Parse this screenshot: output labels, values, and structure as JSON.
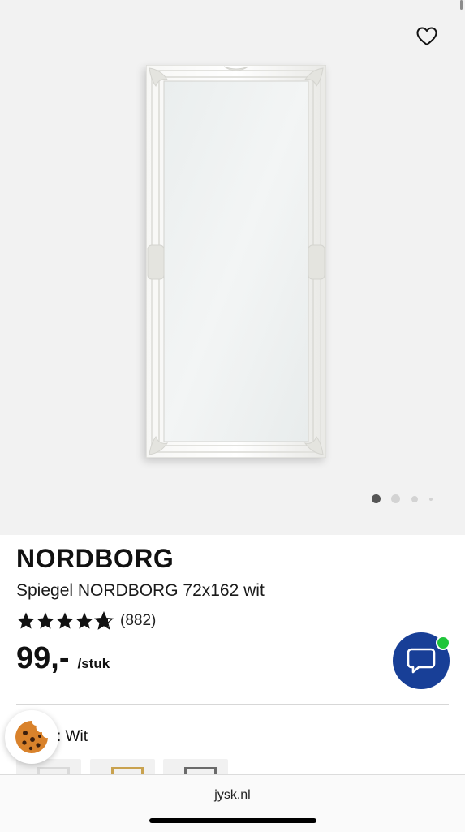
{
  "product": {
    "brand": "NORDBORG",
    "name": "Spiegel NORDBORG 72x162 wit",
    "rating": 4.5,
    "rating_max": 5,
    "review_count": "(882)",
    "price": "99,-",
    "price_unit": "/stuk",
    "color_label": ": Wit"
  },
  "gallery": {
    "image_count": 4,
    "active_index": 0
  },
  "icons": {
    "favorite": "heart-outline-icon",
    "chat": "chat-bubble-icon",
    "cookie": "cookie-icon",
    "star": "star-icon"
  },
  "browser": {
    "url": "jysk.nl"
  },
  "colors": {
    "chat_button": "#183f97",
    "chat_badge": "#1fc53a",
    "star": "#111111",
    "cookie": "#d9822b"
  }
}
